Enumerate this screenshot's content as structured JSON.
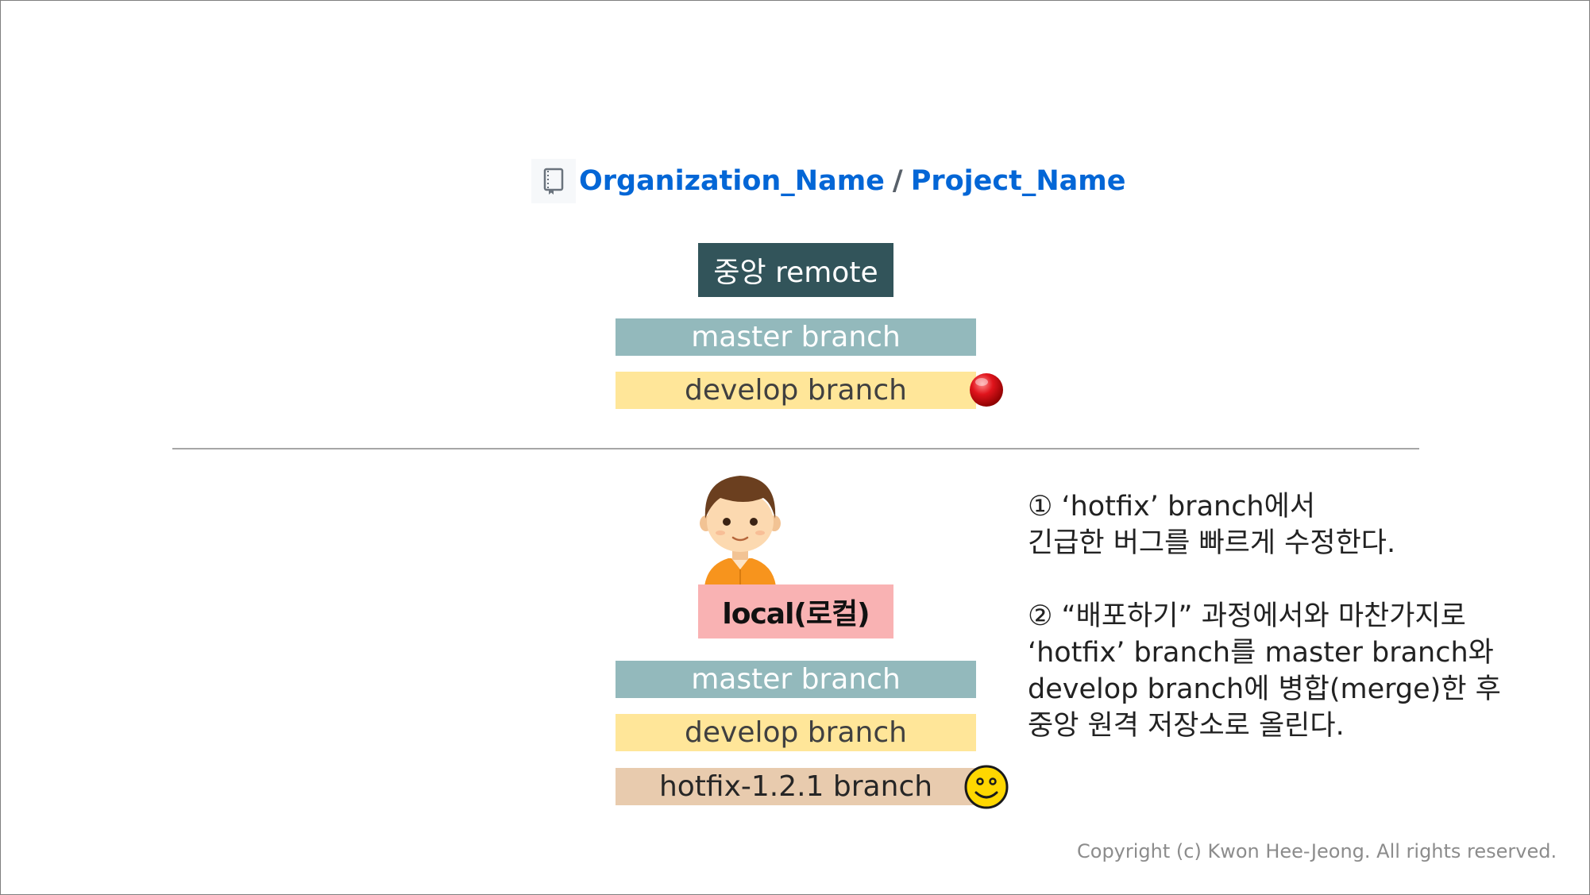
{
  "repo": {
    "organization": "Organization_Name",
    "separator": "/",
    "project": "Project_Name",
    "icon": "repo-book-icon",
    "link_color": "#0366d6"
  },
  "remote": {
    "label": "중앙 remote",
    "master_label": "master branch",
    "develop_label": "develop branch",
    "develop_marker_icon": "red-dot-icon"
  },
  "local": {
    "avatar_icon": "developer-avatar-icon",
    "label": "local(로컬)",
    "master_label": "master branch",
    "develop_label": "develop branch",
    "hotfix_label": "hotfix-1.2.1 branch",
    "hotfix_marker_icon": "smiley-face-icon"
  },
  "description": {
    "step1_line1": "① ‘hotfix’ branch에서",
    "step1_line2": "긴급한 버그를 빠르게 수정한다.",
    "step2_line1": "② “배포하기” 과정에서와 마찬가지로",
    "step2_line2": "‘hotfix’ branch를 master branch와",
    "step2_line3": "develop branch에 병합(merge)한 후",
    "step2_line4": "중앙 원격 저장소로 올린다."
  },
  "copyright": "Copyright (c) Kwon Hee-Jeong. All rights reserved.",
  "colors": {
    "remote_box": "#32545a",
    "master_bar": "#93b9bc",
    "develop_bar": "#ffe699",
    "hotfix_bar": "#e8cbae",
    "local_box": "#f9b2b3"
  }
}
